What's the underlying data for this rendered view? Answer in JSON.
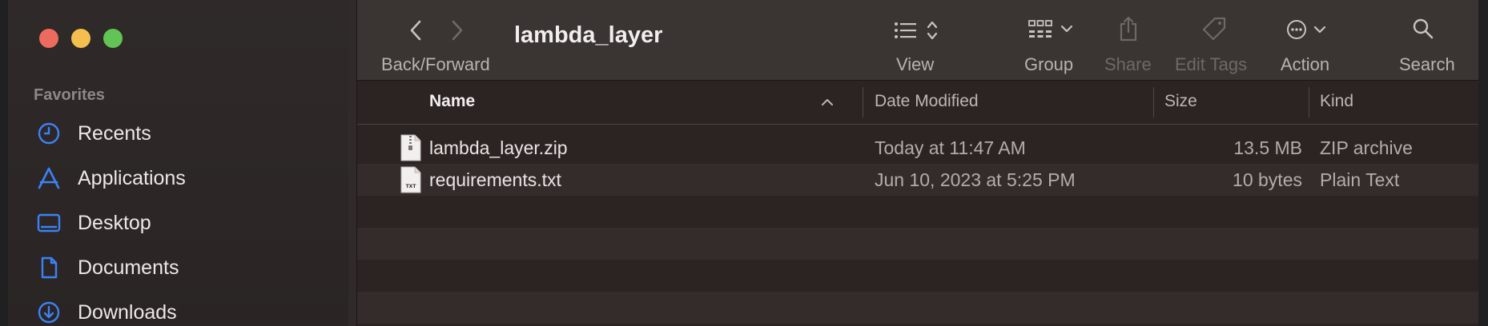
{
  "window": {
    "title": "lambda_layer",
    "controls": {
      "close": "#ed6a5e",
      "minimize": "#f5bf4f",
      "zoom": "#61c454"
    }
  },
  "sidebar": {
    "section": "Favorites",
    "items": [
      {
        "label": "Recents",
        "icon": "clock-icon"
      },
      {
        "label": "Applications",
        "icon": "applications-icon"
      },
      {
        "label": "Desktop",
        "icon": "desktop-icon"
      },
      {
        "label": "Documents",
        "icon": "document-icon"
      },
      {
        "label": "Downloads",
        "icon": "download-icon"
      }
    ],
    "accent": "#3b82f6"
  },
  "toolbar": {
    "nav_label": "Back/Forward",
    "view_label": "View",
    "group_label": "Group",
    "share_label": "Share",
    "edit_tags_label": "Edit Tags",
    "action_label": "Action",
    "search_label": "Search"
  },
  "columns": {
    "name": "Name",
    "date": "Date Modified",
    "size": "Size",
    "kind": "Kind"
  },
  "files": [
    {
      "name": "lambda_layer.zip",
      "date": "Today at 11:47 AM",
      "size": "13.5 MB",
      "kind": "ZIP archive",
      "icon": "zip-file-icon"
    },
    {
      "name": "requirements.txt",
      "date": "Jun 10, 2023 at 5:25 PM",
      "size": "10 bytes",
      "kind": "Plain Text",
      "icon": "text-file-icon",
      "badge": "TXT"
    }
  ]
}
